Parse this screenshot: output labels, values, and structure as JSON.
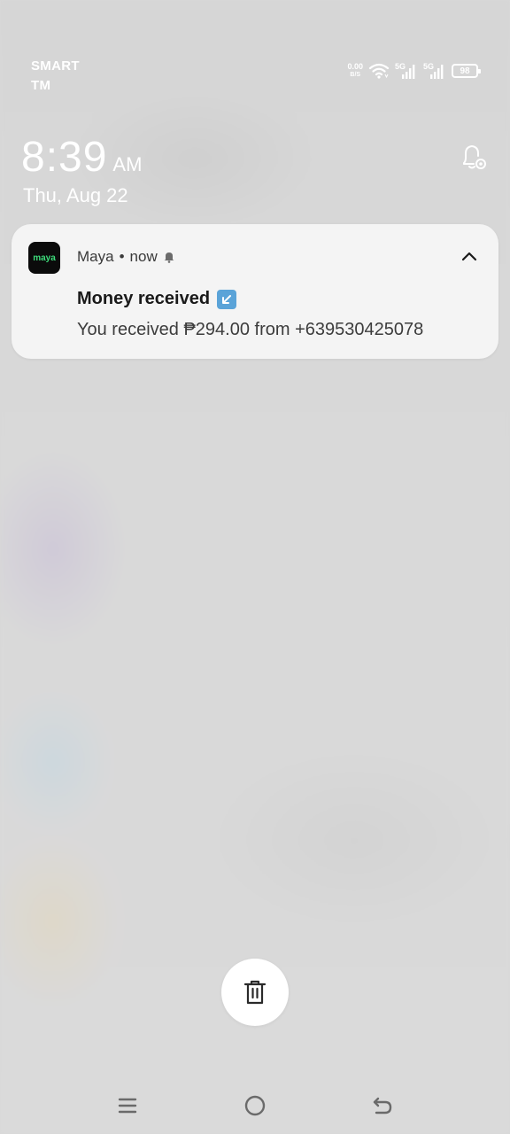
{
  "status_bar": {
    "carrier_line1": "SMART",
    "carrier_line2": "TM",
    "net_speed_value": "0.00",
    "net_speed_unit": "B/S",
    "sim1_tag": "5G",
    "sim2_tag": "5G",
    "battery_level": "98",
    "icons": [
      "wifi-icon",
      "signal-icon",
      "signal-icon",
      "battery-icon"
    ]
  },
  "lockscreen": {
    "time": "8:39",
    "ampm": "AM",
    "date": "Thu, Aug 22",
    "settings_icon": "notification-settings-icon"
  },
  "notification": {
    "app_icon_text": "maya",
    "app_name": "Maya",
    "separator": "•",
    "timestamp": "now",
    "title": "Money received",
    "body": "You received ₱294.00 from +639530425078",
    "colors": {
      "card_bg": "#f4f4f4",
      "app_icon_bg": "#0b0b0b",
      "app_icon_text": "#3ddc7a",
      "emoji_bg": "#5aa3d8"
    }
  },
  "actions": {
    "clear_all_icon": "trash-icon"
  },
  "navbar": {
    "icons": [
      "menu-icon",
      "home-icon",
      "back-icon"
    ]
  }
}
